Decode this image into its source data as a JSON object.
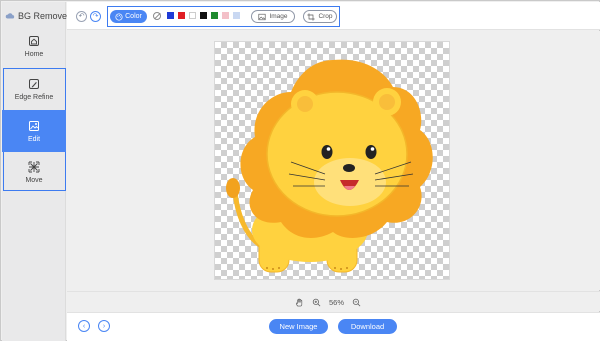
{
  "app": {
    "title": "BG Remover"
  },
  "sidebar": {
    "items": [
      {
        "id": "home",
        "label": "Home",
        "icon": "home-icon"
      },
      {
        "id": "edge-refine",
        "label": "Edge Refine",
        "icon": "edge-refine-icon"
      },
      {
        "id": "edit",
        "label": "Edit",
        "icon": "edit-image-icon",
        "active": true
      },
      {
        "id": "move",
        "label": "Move",
        "icon": "move-icon"
      }
    ]
  },
  "toolbar": {
    "undo_icon": "undo-icon",
    "redo_icon": "redo-icon",
    "color_label": "Color",
    "swatches": [
      "none",
      "#1f3bd6",
      "#e01e24",
      "#ffffff",
      "#111111",
      "#1f8a2e",
      "#f3c0c8",
      "#c9d8f2"
    ],
    "image_label": "Image",
    "crop_label": "Crop"
  },
  "zoom": {
    "hand_icon": "hand-icon",
    "value": "56%"
  },
  "bottom": {
    "new_image_label": "New Image",
    "download_label": "Download"
  },
  "colors": {
    "accent": "#4a86f4",
    "sidebar_bg": "#e9e9ea",
    "lion_body": "#ffd23f",
    "lion_mane": "#f7a823"
  }
}
